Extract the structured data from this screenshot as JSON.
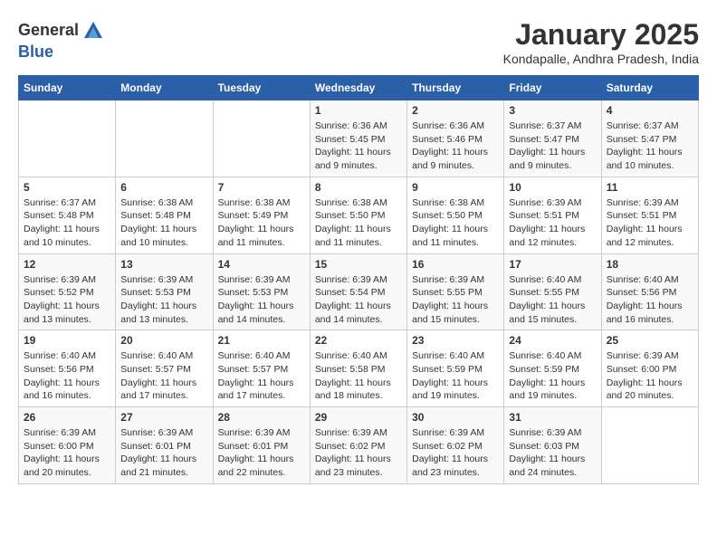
{
  "header": {
    "logo_line1": "General",
    "logo_line2": "Blue",
    "month_year": "January 2025",
    "location": "Kondapalle, Andhra Pradesh, India"
  },
  "weekdays": [
    "Sunday",
    "Monday",
    "Tuesday",
    "Wednesday",
    "Thursday",
    "Friday",
    "Saturday"
  ],
  "weeks": [
    [
      {
        "day": "",
        "info": ""
      },
      {
        "day": "",
        "info": ""
      },
      {
        "day": "",
        "info": ""
      },
      {
        "day": "1",
        "info": "Sunrise: 6:36 AM\nSunset: 5:45 PM\nDaylight: 11 hours and 9 minutes."
      },
      {
        "day": "2",
        "info": "Sunrise: 6:36 AM\nSunset: 5:46 PM\nDaylight: 11 hours and 9 minutes."
      },
      {
        "day": "3",
        "info": "Sunrise: 6:37 AM\nSunset: 5:47 PM\nDaylight: 11 hours and 9 minutes."
      },
      {
        "day": "4",
        "info": "Sunrise: 6:37 AM\nSunset: 5:47 PM\nDaylight: 11 hours and 10 minutes."
      }
    ],
    [
      {
        "day": "5",
        "info": "Sunrise: 6:37 AM\nSunset: 5:48 PM\nDaylight: 11 hours and 10 minutes."
      },
      {
        "day": "6",
        "info": "Sunrise: 6:38 AM\nSunset: 5:48 PM\nDaylight: 11 hours and 10 minutes."
      },
      {
        "day": "7",
        "info": "Sunrise: 6:38 AM\nSunset: 5:49 PM\nDaylight: 11 hours and 11 minutes."
      },
      {
        "day": "8",
        "info": "Sunrise: 6:38 AM\nSunset: 5:50 PM\nDaylight: 11 hours and 11 minutes."
      },
      {
        "day": "9",
        "info": "Sunrise: 6:38 AM\nSunset: 5:50 PM\nDaylight: 11 hours and 11 minutes."
      },
      {
        "day": "10",
        "info": "Sunrise: 6:39 AM\nSunset: 5:51 PM\nDaylight: 11 hours and 12 minutes."
      },
      {
        "day": "11",
        "info": "Sunrise: 6:39 AM\nSunset: 5:51 PM\nDaylight: 11 hours and 12 minutes."
      }
    ],
    [
      {
        "day": "12",
        "info": "Sunrise: 6:39 AM\nSunset: 5:52 PM\nDaylight: 11 hours and 13 minutes."
      },
      {
        "day": "13",
        "info": "Sunrise: 6:39 AM\nSunset: 5:53 PM\nDaylight: 11 hours and 13 minutes."
      },
      {
        "day": "14",
        "info": "Sunrise: 6:39 AM\nSunset: 5:53 PM\nDaylight: 11 hours and 14 minutes."
      },
      {
        "day": "15",
        "info": "Sunrise: 6:39 AM\nSunset: 5:54 PM\nDaylight: 11 hours and 14 minutes."
      },
      {
        "day": "16",
        "info": "Sunrise: 6:39 AM\nSunset: 5:55 PM\nDaylight: 11 hours and 15 minutes."
      },
      {
        "day": "17",
        "info": "Sunrise: 6:40 AM\nSunset: 5:55 PM\nDaylight: 11 hours and 15 minutes."
      },
      {
        "day": "18",
        "info": "Sunrise: 6:40 AM\nSunset: 5:56 PM\nDaylight: 11 hours and 16 minutes."
      }
    ],
    [
      {
        "day": "19",
        "info": "Sunrise: 6:40 AM\nSunset: 5:56 PM\nDaylight: 11 hours and 16 minutes."
      },
      {
        "day": "20",
        "info": "Sunrise: 6:40 AM\nSunset: 5:57 PM\nDaylight: 11 hours and 17 minutes."
      },
      {
        "day": "21",
        "info": "Sunrise: 6:40 AM\nSunset: 5:57 PM\nDaylight: 11 hours and 17 minutes."
      },
      {
        "day": "22",
        "info": "Sunrise: 6:40 AM\nSunset: 5:58 PM\nDaylight: 11 hours and 18 minutes."
      },
      {
        "day": "23",
        "info": "Sunrise: 6:40 AM\nSunset: 5:59 PM\nDaylight: 11 hours and 19 minutes."
      },
      {
        "day": "24",
        "info": "Sunrise: 6:40 AM\nSunset: 5:59 PM\nDaylight: 11 hours and 19 minutes."
      },
      {
        "day": "25",
        "info": "Sunrise: 6:39 AM\nSunset: 6:00 PM\nDaylight: 11 hours and 20 minutes."
      }
    ],
    [
      {
        "day": "26",
        "info": "Sunrise: 6:39 AM\nSunset: 6:00 PM\nDaylight: 11 hours and 20 minutes."
      },
      {
        "day": "27",
        "info": "Sunrise: 6:39 AM\nSunset: 6:01 PM\nDaylight: 11 hours and 21 minutes."
      },
      {
        "day": "28",
        "info": "Sunrise: 6:39 AM\nSunset: 6:01 PM\nDaylight: 11 hours and 22 minutes."
      },
      {
        "day": "29",
        "info": "Sunrise: 6:39 AM\nSunset: 6:02 PM\nDaylight: 11 hours and 23 minutes."
      },
      {
        "day": "30",
        "info": "Sunrise: 6:39 AM\nSunset: 6:02 PM\nDaylight: 11 hours and 23 minutes."
      },
      {
        "day": "31",
        "info": "Sunrise: 6:39 AM\nSunset: 6:03 PM\nDaylight: 11 hours and 24 minutes."
      },
      {
        "day": "",
        "info": ""
      }
    ]
  ]
}
